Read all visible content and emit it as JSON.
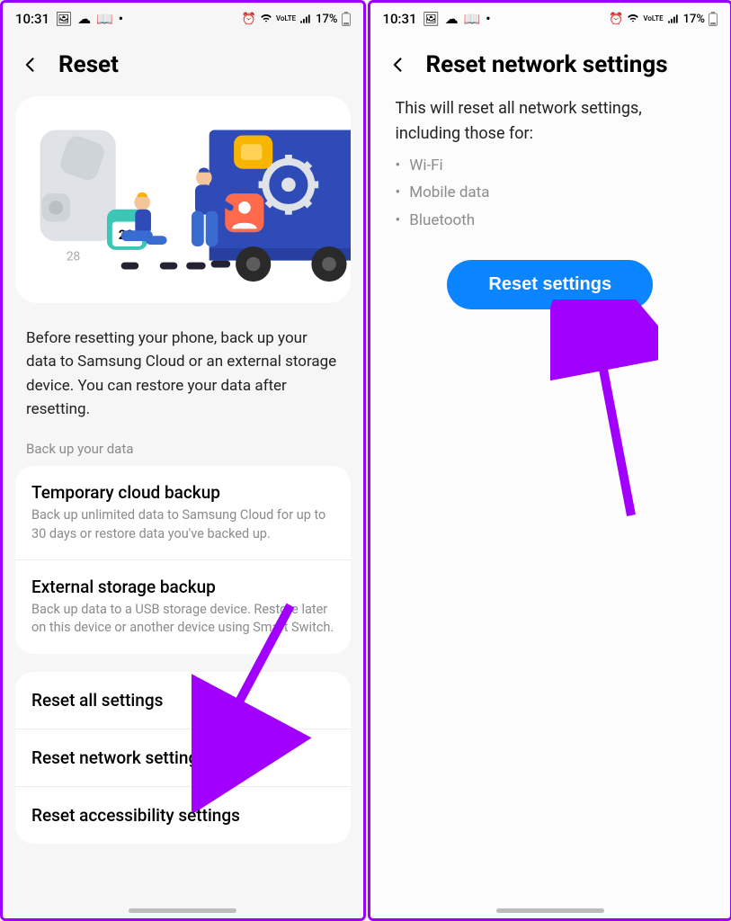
{
  "status": {
    "time": "10:31",
    "battery_pct": "17%"
  },
  "left": {
    "title": "Reset",
    "intro": "Before resetting your phone, back up your data to Samsung Cloud or an external storage device. You can restore your data after resetting.",
    "backup_label": "Back up your data",
    "backup_options": [
      {
        "title": "Temporary cloud backup",
        "sub": "Back up unlimited data to Samsung Cloud for up to 30 days or restore data you've backed up."
      },
      {
        "title": "External storage backup",
        "sub": "Back up data to a USB storage device. Restore later on this device or another device using Smart Switch."
      }
    ],
    "reset_options": [
      {
        "title": "Reset all settings"
      },
      {
        "title": "Reset network settings"
      },
      {
        "title": "Reset accessibility settings"
      }
    ]
  },
  "right": {
    "title": "Reset network settings",
    "desc": "This will reset all network settings, including those for:",
    "bullets": [
      "Wi-Fi",
      "Mobile data",
      "Bluetooth"
    ],
    "cta": "Reset settings"
  },
  "colors": {
    "accent": "#0a84ff",
    "arrow": "#a100ff"
  }
}
